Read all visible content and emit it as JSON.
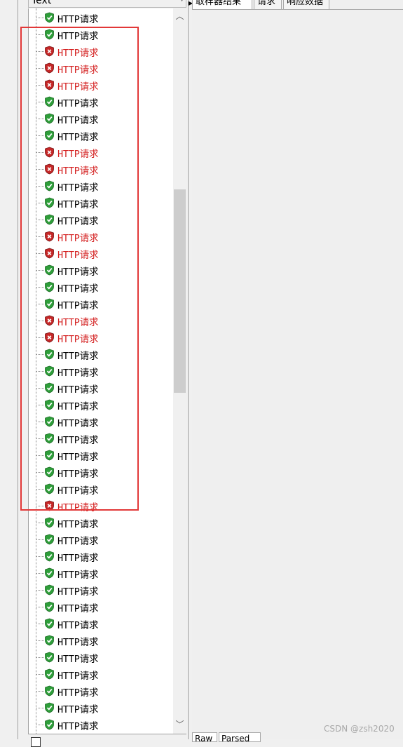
{
  "tree": {
    "header_label": "Text",
    "items": [
      {
        "label": "HTTP请求",
        "status": "success"
      },
      {
        "label": "HTTP请求",
        "status": "success"
      },
      {
        "label": "HTTP请求",
        "status": "error"
      },
      {
        "label": "HTTP请求",
        "status": "error"
      },
      {
        "label": "HTTP请求",
        "status": "error"
      },
      {
        "label": "HTTP请求",
        "status": "success"
      },
      {
        "label": "HTTP请求",
        "status": "success"
      },
      {
        "label": "HTTP请求",
        "status": "success"
      },
      {
        "label": "HTTP请求",
        "status": "error"
      },
      {
        "label": "HTTP请求",
        "status": "error"
      },
      {
        "label": "HTTP请求",
        "status": "success"
      },
      {
        "label": "HTTP请求",
        "status": "success"
      },
      {
        "label": "HTTP请求",
        "status": "success"
      },
      {
        "label": "HTTP请求",
        "status": "error"
      },
      {
        "label": "HTTP请求",
        "status": "error"
      },
      {
        "label": "HTTP请求",
        "status": "success"
      },
      {
        "label": "HTTP请求",
        "status": "success"
      },
      {
        "label": "HTTP请求",
        "status": "success"
      },
      {
        "label": "HTTP请求",
        "status": "error"
      },
      {
        "label": "HTTP请求",
        "status": "error"
      },
      {
        "label": "HTTP请求",
        "status": "success"
      },
      {
        "label": "HTTP请求",
        "status": "success"
      },
      {
        "label": "HTTP请求",
        "status": "success"
      },
      {
        "label": "HTTP请求",
        "status": "success"
      },
      {
        "label": "HTTP请求",
        "status": "success"
      },
      {
        "label": "HTTP请求",
        "status": "success"
      },
      {
        "label": "HTTP请求",
        "status": "success"
      },
      {
        "label": "HTTP请求",
        "status": "success"
      },
      {
        "label": "HTTP请求",
        "status": "success"
      },
      {
        "label": "HTTP请求",
        "status": "error"
      },
      {
        "label": "HTTP请求",
        "status": "success"
      },
      {
        "label": "HTTP请求",
        "status": "success"
      },
      {
        "label": "HTTP请求",
        "status": "success"
      },
      {
        "label": "HTTP请求",
        "status": "success"
      },
      {
        "label": "HTTP请求",
        "status": "success"
      },
      {
        "label": "HTTP请求",
        "status": "success"
      },
      {
        "label": "HTTP请求",
        "status": "success"
      },
      {
        "label": "HTTP请求",
        "status": "success"
      },
      {
        "label": "HTTP请求",
        "status": "success"
      },
      {
        "label": "HTTP请求",
        "status": "success"
      },
      {
        "label": "HTTP请求",
        "status": "success"
      },
      {
        "label": "HTTP请求",
        "status": "success"
      },
      {
        "label": "HTTP请求",
        "status": "success"
      }
    ]
  },
  "tabs": [
    "取样器结果",
    "请求",
    "响应数据"
  ],
  "bottom_tabs": [
    "Raw",
    "Parsed"
  ],
  "watermark": "CSDN @zsh2020",
  "colors": {
    "success_icon": "#2e9e3a",
    "error_icon": "#c62828",
    "error_text": "#d42020",
    "highlight_box": "#e23838"
  }
}
